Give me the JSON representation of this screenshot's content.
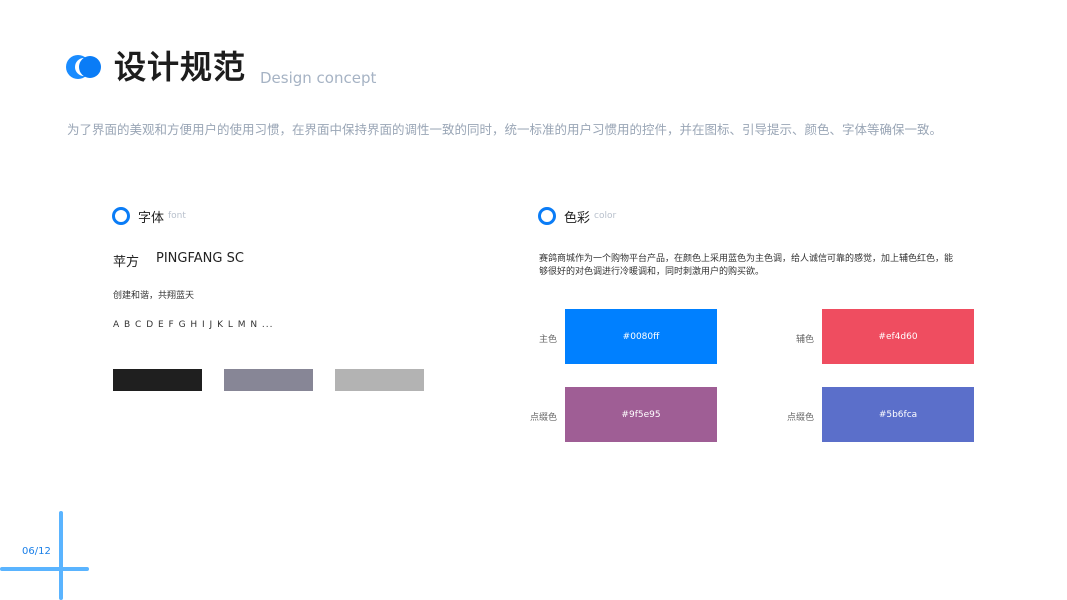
{
  "header": {
    "title": "设计规范",
    "subtitle": "Design concept",
    "intro": "为了界面的美观和方便用户的使用习惯，在界面中保持界面的调性一致的同时，统一标准的用户习惯用的控件，并在图标、引导提示、颜色、字体等确保一致。"
  },
  "font_section": {
    "title": "字体",
    "subtitle": "font",
    "font_name_cn": "苹方",
    "font_name_en": "PINGFANG SC",
    "sample_text": "创建和谐，共翔蓝天",
    "alphabet": "A B C D E F G H I J K L M N ...",
    "swatches": [
      {
        "color": "#1f1f1f"
      },
      {
        "color": "#878696"
      },
      {
        "color": "#b3b3b3"
      }
    ]
  },
  "color_section": {
    "title": "色彩",
    "subtitle": "color",
    "description": "赛鸽商城作为一个购物平台产品，在颜色上采用蓝色为主色调，给人诚信可靠的感觉，加上辅色红色，能够很好的对色调进行冷暖调和，同时刺激用户的购买欲。",
    "swatches": [
      {
        "label": "主色",
        "hex": "#0080ff"
      },
      {
        "label": "辅色",
        "hex": "#ef4d60"
      },
      {
        "label": "点缀色",
        "hex": "#9f5e95"
      },
      {
        "label": "点缀色",
        "hex": "#5b6fca"
      }
    ]
  },
  "footer": {
    "page_number": "06/12"
  },
  "colors": {
    "accent": "#0a7cf6",
    "page_indicator": "#5ab4ff"
  }
}
